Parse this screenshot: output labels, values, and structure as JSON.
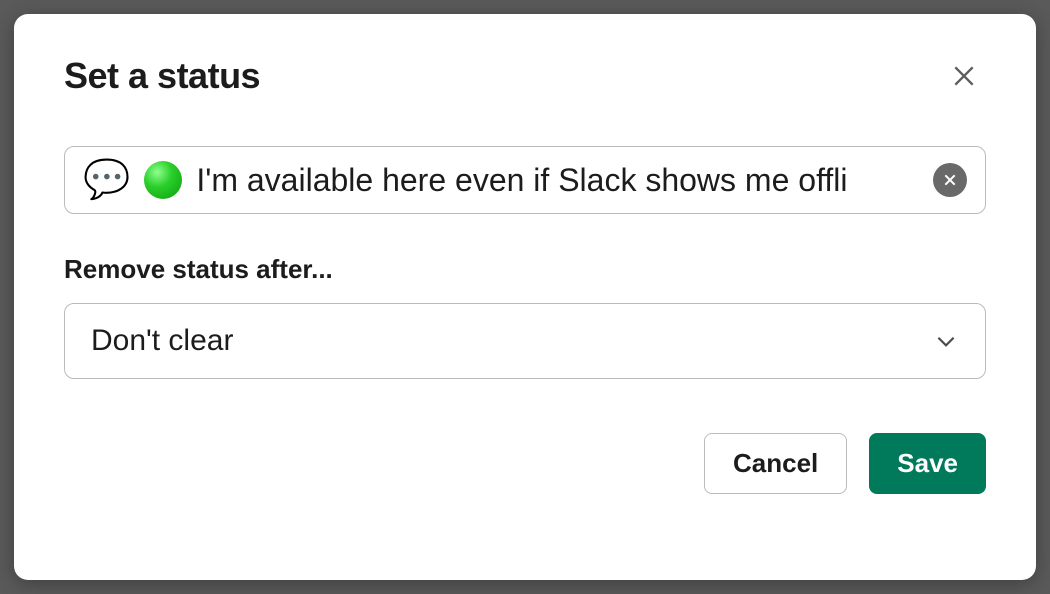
{
  "modal": {
    "title": "Set a status",
    "status_input": {
      "emoji_name": "speech-balloon",
      "presence_name": "green-circle",
      "text": "I'm available here even if Slack shows me offli"
    },
    "remove_section": {
      "label": "Remove status after...",
      "selected": "Don't clear"
    },
    "buttons": {
      "cancel": "Cancel",
      "save": "Save"
    }
  }
}
